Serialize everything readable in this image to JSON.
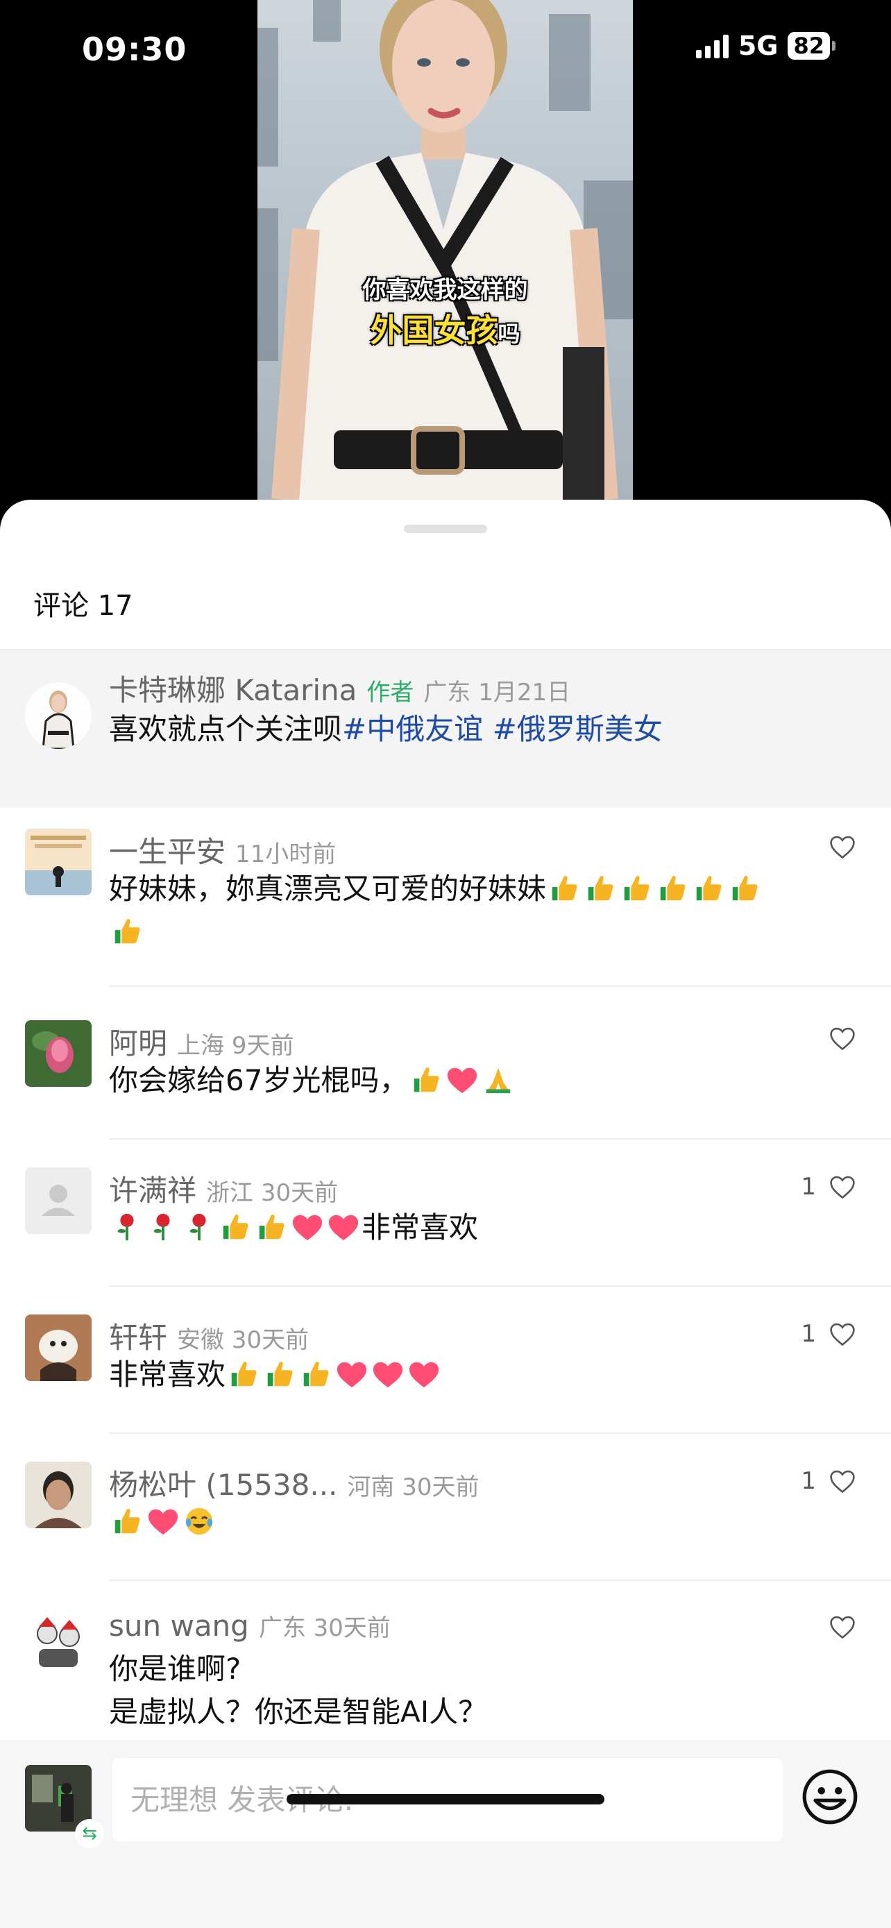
{
  "status_bar": {
    "time": "09:30",
    "network": "5G",
    "battery": "82"
  },
  "video": {
    "caption_line1": "你喜欢我这样的",
    "caption_line2_highlight": "外国女孩",
    "caption_line2_suffix": "吗"
  },
  "comments_panel": {
    "title": "评论 17",
    "author_comment": {
      "name": "卡特琳娜 Katarina",
      "badge": "作者",
      "meta": "广东 1月21日",
      "text": "喜欢就点个关注呗",
      "topics": [
        "#中俄友谊",
        "#俄罗斯美女"
      ]
    },
    "comments": [
      {
        "name": "一生平安",
        "meta": "11小时前",
        "likes": "",
        "text_line1": "好妹妹，妳真漂亮又可爱的好妹妹",
        "emoji_line1": [
          "thumbs-up",
          "thumbs-up",
          "thumbs-up",
          "thumbs-up",
          "thumbs-up",
          "thumbs-up"
        ],
        "emoji_line2": [
          "thumbs-up"
        ]
      },
      {
        "name": "阿明",
        "meta": "上海 9天前",
        "likes": "",
        "text": "你会嫁给67岁光棍吗，",
        "emoji_after": [
          "thumbs-up",
          "heart",
          "pray"
        ]
      },
      {
        "name": "许满祥",
        "meta": "浙江 30天前",
        "likes": "1",
        "emoji_before": [
          "rose",
          "rose",
          "rose",
          "thumbs-up",
          "thumbs-up",
          "heart",
          "heart"
        ],
        "text": "非常喜欢"
      },
      {
        "name": "轩轩",
        "meta": "安徽 30天前",
        "likes": "1",
        "text": "非常喜欢",
        "emoji_after": [
          "thumbs-up",
          "thumbs-up",
          "thumbs-up",
          "heart",
          "heart",
          "heart"
        ]
      },
      {
        "name": "杨松叶 (15538...",
        "meta": "河南 30天前",
        "likes": "1",
        "emoji_only": [
          "thumbs-up",
          "heart",
          "cry-laugh"
        ]
      },
      {
        "name": "sun wang",
        "meta": "广东 30天前",
        "likes": "",
        "line1": "你是谁啊?",
        "line2": "是虚拟人？你还是智能AI人？"
      }
    ]
  },
  "input_bar": {
    "placeholder": "无理想 发表评论:"
  },
  "colors": {
    "topic_link": "#1e4aa8",
    "author_badge": "#2aae67",
    "caption_highlight": "#ffe033"
  }
}
